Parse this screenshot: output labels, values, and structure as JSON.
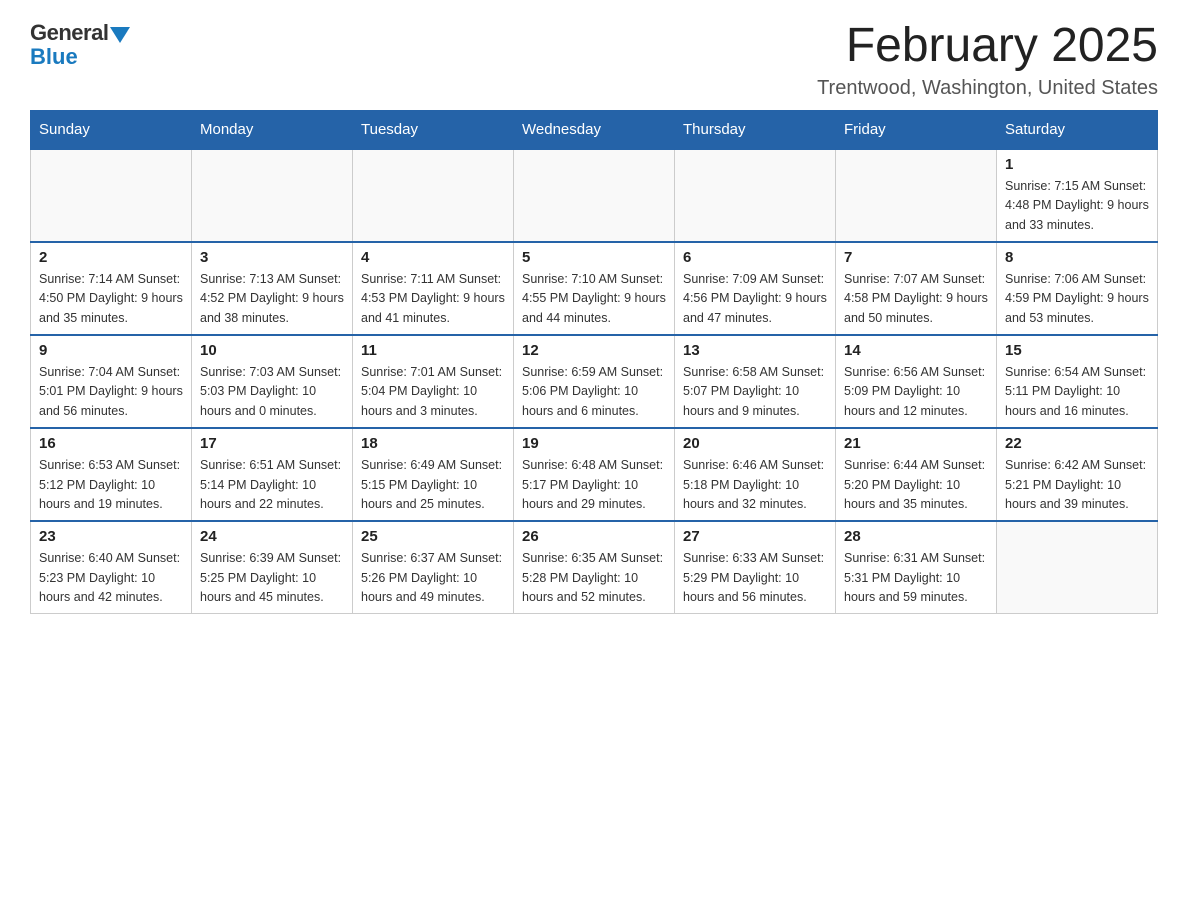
{
  "logo": {
    "general": "General",
    "blue": "Blue"
  },
  "title": {
    "month": "February 2025",
    "location": "Trentwood, Washington, United States"
  },
  "weekdays": [
    "Sunday",
    "Monday",
    "Tuesday",
    "Wednesday",
    "Thursday",
    "Friday",
    "Saturday"
  ],
  "weeks": [
    [
      {
        "day": "",
        "info": ""
      },
      {
        "day": "",
        "info": ""
      },
      {
        "day": "",
        "info": ""
      },
      {
        "day": "",
        "info": ""
      },
      {
        "day": "",
        "info": ""
      },
      {
        "day": "",
        "info": ""
      },
      {
        "day": "1",
        "info": "Sunrise: 7:15 AM\nSunset: 4:48 PM\nDaylight: 9 hours and 33 minutes."
      }
    ],
    [
      {
        "day": "2",
        "info": "Sunrise: 7:14 AM\nSunset: 4:50 PM\nDaylight: 9 hours and 35 minutes."
      },
      {
        "day": "3",
        "info": "Sunrise: 7:13 AM\nSunset: 4:52 PM\nDaylight: 9 hours and 38 minutes."
      },
      {
        "day": "4",
        "info": "Sunrise: 7:11 AM\nSunset: 4:53 PM\nDaylight: 9 hours and 41 minutes."
      },
      {
        "day": "5",
        "info": "Sunrise: 7:10 AM\nSunset: 4:55 PM\nDaylight: 9 hours and 44 minutes."
      },
      {
        "day": "6",
        "info": "Sunrise: 7:09 AM\nSunset: 4:56 PM\nDaylight: 9 hours and 47 minutes."
      },
      {
        "day": "7",
        "info": "Sunrise: 7:07 AM\nSunset: 4:58 PM\nDaylight: 9 hours and 50 minutes."
      },
      {
        "day": "8",
        "info": "Sunrise: 7:06 AM\nSunset: 4:59 PM\nDaylight: 9 hours and 53 minutes."
      }
    ],
    [
      {
        "day": "9",
        "info": "Sunrise: 7:04 AM\nSunset: 5:01 PM\nDaylight: 9 hours and 56 minutes."
      },
      {
        "day": "10",
        "info": "Sunrise: 7:03 AM\nSunset: 5:03 PM\nDaylight: 10 hours and 0 minutes."
      },
      {
        "day": "11",
        "info": "Sunrise: 7:01 AM\nSunset: 5:04 PM\nDaylight: 10 hours and 3 minutes."
      },
      {
        "day": "12",
        "info": "Sunrise: 6:59 AM\nSunset: 5:06 PM\nDaylight: 10 hours and 6 minutes."
      },
      {
        "day": "13",
        "info": "Sunrise: 6:58 AM\nSunset: 5:07 PM\nDaylight: 10 hours and 9 minutes."
      },
      {
        "day": "14",
        "info": "Sunrise: 6:56 AM\nSunset: 5:09 PM\nDaylight: 10 hours and 12 minutes."
      },
      {
        "day": "15",
        "info": "Sunrise: 6:54 AM\nSunset: 5:11 PM\nDaylight: 10 hours and 16 minutes."
      }
    ],
    [
      {
        "day": "16",
        "info": "Sunrise: 6:53 AM\nSunset: 5:12 PM\nDaylight: 10 hours and 19 minutes."
      },
      {
        "day": "17",
        "info": "Sunrise: 6:51 AM\nSunset: 5:14 PM\nDaylight: 10 hours and 22 minutes."
      },
      {
        "day": "18",
        "info": "Sunrise: 6:49 AM\nSunset: 5:15 PM\nDaylight: 10 hours and 25 minutes."
      },
      {
        "day": "19",
        "info": "Sunrise: 6:48 AM\nSunset: 5:17 PM\nDaylight: 10 hours and 29 minutes."
      },
      {
        "day": "20",
        "info": "Sunrise: 6:46 AM\nSunset: 5:18 PM\nDaylight: 10 hours and 32 minutes."
      },
      {
        "day": "21",
        "info": "Sunrise: 6:44 AM\nSunset: 5:20 PM\nDaylight: 10 hours and 35 minutes."
      },
      {
        "day": "22",
        "info": "Sunrise: 6:42 AM\nSunset: 5:21 PM\nDaylight: 10 hours and 39 minutes."
      }
    ],
    [
      {
        "day": "23",
        "info": "Sunrise: 6:40 AM\nSunset: 5:23 PM\nDaylight: 10 hours and 42 minutes."
      },
      {
        "day": "24",
        "info": "Sunrise: 6:39 AM\nSunset: 5:25 PM\nDaylight: 10 hours and 45 minutes."
      },
      {
        "day": "25",
        "info": "Sunrise: 6:37 AM\nSunset: 5:26 PM\nDaylight: 10 hours and 49 minutes."
      },
      {
        "day": "26",
        "info": "Sunrise: 6:35 AM\nSunset: 5:28 PM\nDaylight: 10 hours and 52 minutes."
      },
      {
        "day": "27",
        "info": "Sunrise: 6:33 AM\nSunset: 5:29 PM\nDaylight: 10 hours and 56 minutes."
      },
      {
        "day": "28",
        "info": "Sunrise: 6:31 AM\nSunset: 5:31 PM\nDaylight: 10 hours and 59 minutes."
      },
      {
        "day": "",
        "info": ""
      }
    ]
  ]
}
